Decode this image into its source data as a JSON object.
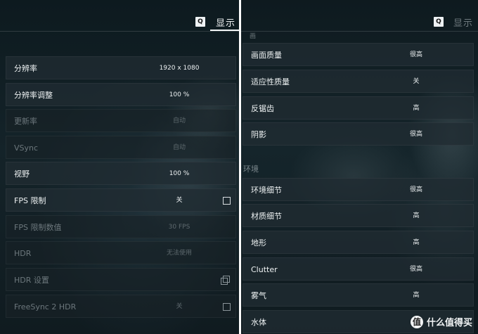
{
  "left_panel": {
    "header": {
      "q_key": "Q",
      "title": "显示"
    },
    "rows": [
      {
        "label": "分辨率",
        "value": "1920 x 1080",
        "dim": false
      },
      {
        "label": "分辨率调整",
        "value": "100 %",
        "dim": false
      },
      {
        "label": "更新率",
        "value": "自动",
        "dim": true
      },
      {
        "label": "VSync",
        "value": "自动",
        "dim": true
      },
      {
        "label": "视野",
        "value": "100 %",
        "dim": false
      },
      {
        "label": "FPS 限制",
        "value": "关",
        "dim": false
      },
      {
        "label": "FPS 限制数值",
        "value": "30 FPS",
        "dim": true
      },
      {
        "label": "HDR",
        "value": "无法使用",
        "dim": true
      },
      {
        "label": "HDR 设置",
        "value": "",
        "dim": true
      },
      {
        "label": "FreeSync 2 HDR",
        "value": "关",
        "dim": true
      }
    ]
  },
  "right_panel": {
    "header": {
      "q_key": "Q",
      "title": "显示"
    },
    "partial_section_label": "画",
    "rows": [
      {
        "label": "画面质量",
        "value": "很高"
      },
      {
        "label": "适应性质量",
        "value": "关"
      },
      {
        "label": "反锯齿",
        "value": "高"
      },
      {
        "label": "阴影",
        "value": "很高"
      }
    ],
    "section_environment": "环境",
    "env_rows": [
      {
        "label": "环境细节",
        "value": "很高"
      },
      {
        "label": "材质细节",
        "value": "高"
      },
      {
        "label": "地形",
        "value": "高"
      },
      {
        "label": "Clutter",
        "value": "很高"
      },
      {
        "label": "雾气",
        "value": "高"
      },
      {
        "label": "水体",
        "value": ""
      }
    ]
  },
  "watermark": {
    "badge": "值",
    "text": "什么值得买"
  },
  "icons": {
    "checkbox": "checkbox-icon",
    "copy": "copy-icon"
  }
}
